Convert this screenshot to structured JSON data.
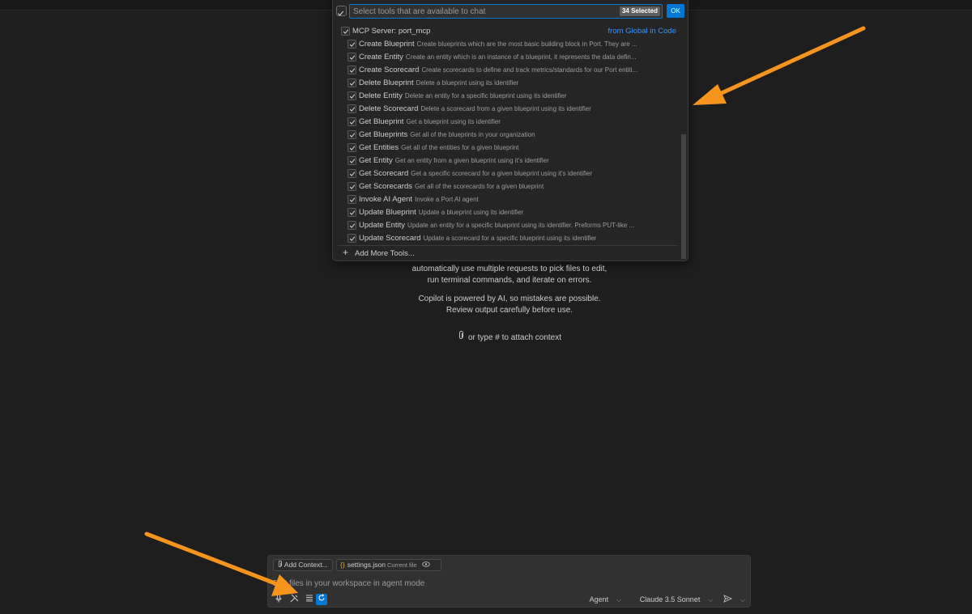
{
  "quickpick": {
    "placeholder": "Select tools that are available to chat",
    "selected_count": "34 Selected",
    "ok_label": "OK",
    "server_label": "MCP Server: port_mcp",
    "server_source": "from Global in Code",
    "items": [
      {
        "label": "Create Blueprint",
        "desc": "Create blueprints which are the most basic building block in Port. They are ..."
      },
      {
        "label": "Create Entity",
        "desc": "Create an entity which is an instance of a blueprint, it represents the data defin..."
      },
      {
        "label": "Create Scorecard",
        "desc": "Create scorecards to define and track metrics/standards for our Port entiti..."
      },
      {
        "label": "Delete Blueprint",
        "desc": "Delete a blueprint using its identifier"
      },
      {
        "label": "Delete Entity",
        "desc": "Delete an entity for a specific blueprint using its identifier"
      },
      {
        "label": "Delete Scorecard",
        "desc": "Delete a scorecard from a given blueprint using its identifier"
      },
      {
        "label": "Get Blueprint",
        "desc": "Get a blueprint using its identifier"
      },
      {
        "label": "Get Blueprints",
        "desc": "Get all of the blueprints in your organization"
      },
      {
        "label": "Get Entities",
        "desc": "Get all of the entities for a given blueprint"
      },
      {
        "label": "Get Entity",
        "desc": "Get an entity from a given blueprint using it's identifier"
      },
      {
        "label": "Get Scorecard",
        "desc": "Get a specific scorecard for a given blueprint using it's identifier"
      },
      {
        "label": "Get Scorecards",
        "desc": "Get all of the scorecards for a given blueprint"
      },
      {
        "label": "Invoke AI Agent",
        "desc": "Invoke a Port AI agent"
      },
      {
        "label": "Update Blueprint",
        "desc": "Update a blueprint using its identifier"
      },
      {
        "label": "Update Entity",
        "desc": "Update an entity for a specific blueprint using its identifier. Preforms PUT-like ..."
      },
      {
        "label": "Update Scorecard",
        "desc": "Update a scorecard for a specific blueprint using its identifier"
      }
    ],
    "add_more": "Add More Tools..."
  },
  "welcome": {
    "line1": "automatically use multiple requests to pick files to edit,",
    "line2": "run terminal commands, and iterate on errors.",
    "line3": "Copilot is powered by AI, so mistakes are possible.",
    "line4": "Review output carefully before use.",
    "attach_hint": "or type # to attach context"
  },
  "chat": {
    "add_context": "Add Context...",
    "file_chip": "settings.json",
    "file_chip_sub": "Current file",
    "placeholder": "Edit files in your workspace in agent mode",
    "mode": "Agent",
    "model": "Claude 3.5 Sonnet"
  },
  "colors": {
    "accent": "#0078d4",
    "link": "#3794ff",
    "arrow": "#f7941d",
    "background": "#1e1e1e"
  }
}
